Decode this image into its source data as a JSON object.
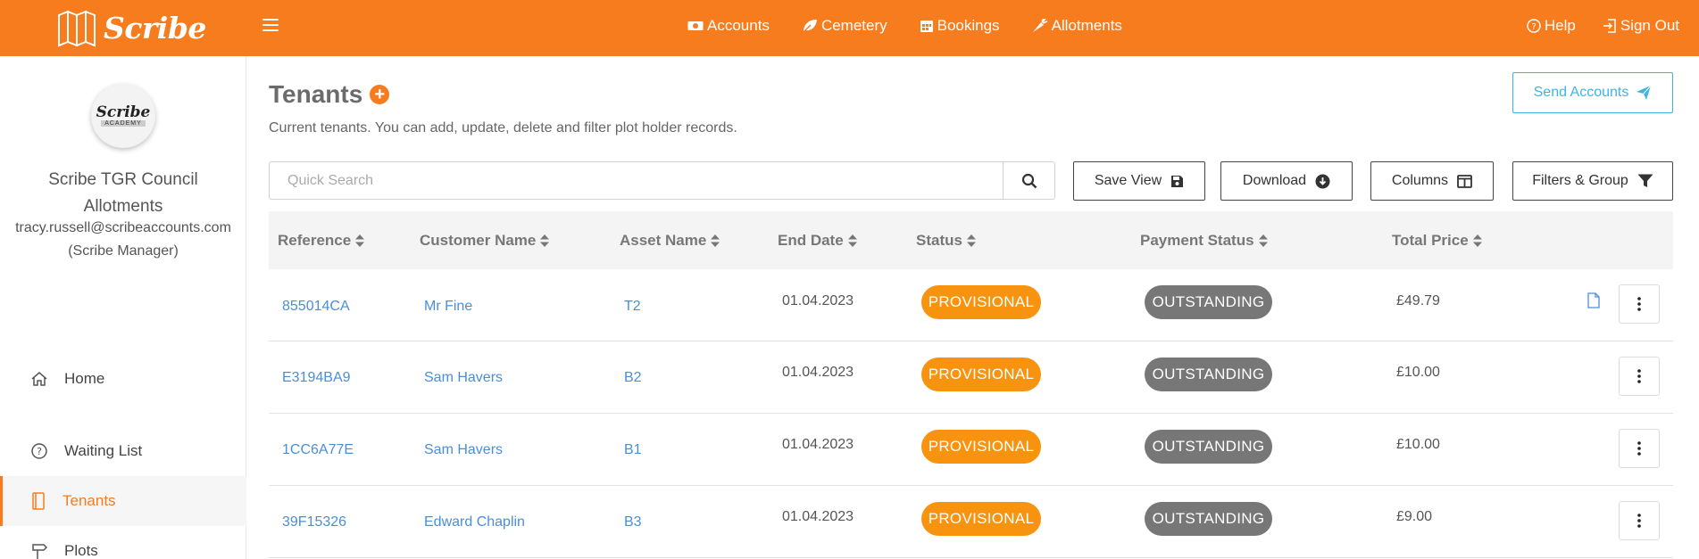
{
  "app": {
    "logo_text": "Scribe"
  },
  "nav": {
    "items": [
      {
        "label": "Accounts",
        "icon": "money-icon"
      },
      {
        "label": "Cemetery",
        "icon": "leaf-icon"
      },
      {
        "label": "Bookings",
        "icon": "calendar-icon"
      },
      {
        "label": "Allotments",
        "icon": "carrot-icon"
      }
    ],
    "help": "Help",
    "sign_out": "Sign Out"
  },
  "sidebar": {
    "avatar_line1": "Scribe",
    "avatar_line2": "ACADEMY",
    "org_line1": "Scribe TGR Council",
    "org_line2": "Allotments",
    "email": "tracy.russell@scribeaccounts.com",
    "role": "(Scribe Manager)",
    "items": [
      {
        "label": "Home",
        "icon": "home-icon"
      },
      {
        "label": "Waiting List",
        "icon": "question-circle-icon"
      },
      {
        "label": "Tenants",
        "icon": "book-icon",
        "active": true
      },
      {
        "label": "Plots",
        "icon": "signpost-icon"
      }
    ]
  },
  "page": {
    "title": "Tenants",
    "subtitle": "Current tenants. You can add, update, delete and filter plot holder records.",
    "send_accounts": "Send Accounts"
  },
  "toolbar": {
    "search_placeholder": "Quick Search",
    "save_view": "Save View",
    "download": "Download",
    "columns": "Columns",
    "filters": "Filters & Group"
  },
  "table": {
    "headers": [
      "Reference",
      "Customer Name",
      "Asset Name",
      "End Date",
      "Status",
      "Payment Status",
      "Total Price"
    ],
    "rows": [
      {
        "reference": "855014CA",
        "customer": "Mr Fine",
        "asset": "T2",
        "end_date": "01.04.2023",
        "status": "PROVISIONAL",
        "payment": "OUTSTANDING",
        "price": "£49.79"
      },
      {
        "reference": "E3194BA9",
        "customer": "Sam Havers",
        "asset": "B2",
        "end_date": "01.04.2023",
        "status": "PROVISIONAL",
        "payment": "OUTSTANDING",
        "price": "£10.00"
      },
      {
        "reference": "1CC6A77E",
        "customer": "Sam Havers",
        "asset": "B1",
        "end_date": "01.04.2023",
        "status": "PROVISIONAL",
        "payment": "OUTSTANDING",
        "price": "£10.00"
      },
      {
        "reference": "39F15326",
        "customer": "Edward Chaplin",
        "asset": "B3",
        "end_date": "01.04.2023",
        "status": "PROVISIONAL",
        "payment": "OUTSTANDING",
        "price": "£9.00"
      }
    ]
  },
  "colors": {
    "brand": "#f77c1e",
    "link": "#4a8fd6",
    "provisional": "#f7930e",
    "outstanding": "#777777",
    "send": "#3eb4e4"
  }
}
